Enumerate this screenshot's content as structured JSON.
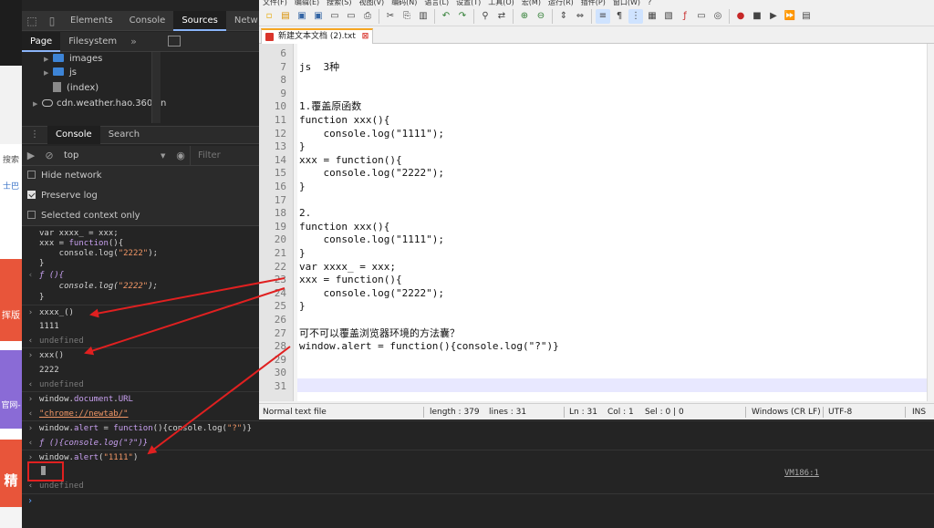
{
  "background_page": {
    "search_text": "搜索",
    "link_text": "士巴",
    "card1_label": "挥版",
    "card2_label": "官网-",
    "card3_label": "精"
  },
  "devtools": {
    "tabs": [
      "Elements",
      "Console",
      "Sources",
      "Netw"
    ],
    "active_tab": "Sources",
    "sources_nav": {
      "page_tab": "Page",
      "filesystem_tab": "Filesystem",
      "more": "»"
    },
    "tree": {
      "images": "images",
      "js": "js",
      "index": "(index)",
      "domain": "cdn.weather.hao.360.cn"
    },
    "drawer_tabs": {
      "console": "Console",
      "search": "Search"
    },
    "console_toolbar": {
      "context": "top",
      "filter_placeholder": "Filter"
    },
    "settings": {
      "hide_network": "Hide network",
      "preserve_log": "Preserve log",
      "selected_context": "Selected context only"
    },
    "console_lines": {
      "l1": "var xxxx_ = xxx;",
      "l2a": "xxx = ",
      "l2b": "function",
      "l2c": "(){",
      "l3a": "    console.log(",
      "l3b": "\"2222\"",
      "l3c": ");",
      "l4": "}",
      "l5a": "ƒ (){",
      "l6a": "    console.log(",
      "l6b": "\"2222\"",
      "l6c": ");",
      "l7": "}",
      "l8": "xxxx_()",
      "l9": "1111",
      "l10": "undefined",
      "l11": "xxx()",
      "l12": "2222",
      "l13": "undefined",
      "l14a": "window.",
      "l14b": "document",
      "l14c": ".",
      "l14d": "URL",
      "l15": "\"chrome://newtab/\"",
      "l16a": "window.",
      "l16b": "alert",
      "l16c": " = ",
      "l16d": "function",
      "l16e": "(){console.log(",
      "l16f": "\"?\"",
      "l16g": ")}",
      "l17": "ƒ (){console.log(\"?\")}",
      "l18a": "window.",
      "l18b": "alert",
      "l18c": "(",
      "l18d": "\"1111\"",
      "l18e": ")",
      "l19": "undefined",
      "vm_link": "VM186:1"
    }
  },
  "notepad": {
    "menu": [
      "文件(F)",
      "编辑(E)",
      "搜索(S)",
      "视图(V)",
      "编码(N)",
      "语言(L)",
      "设置(T)",
      "工具(O)",
      "宏(M)",
      "运行(R)",
      "插件(P)",
      "窗口(W)",
      "?"
    ],
    "tab_title": "新建文本文档 (2).txt",
    "lines": [
      {
        "n": "6",
        "t": ""
      },
      {
        "n": "7",
        "t": "js  3种"
      },
      {
        "n": "8",
        "t": ""
      },
      {
        "n": "9",
        "t": ""
      },
      {
        "n": "10",
        "t": "1.覆盖原函数"
      },
      {
        "n": "11",
        "t": "function xxx(){"
      },
      {
        "n": "12",
        "t": "    console.log(\"1111\");"
      },
      {
        "n": "13",
        "t": "}"
      },
      {
        "n": "14",
        "t": "xxx = function(){"
      },
      {
        "n": "15",
        "t": "    console.log(\"2222\");"
      },
      {
        "n": "16",
        "t": "}"
      },
      {
        "n": "17",
        "t": ""
      },
      {
        "n": "18",
        "t": "2."
      },
      {
        "n": "19",
        "t": "function xxx(){"
      },
      {
        "n": "20",
        "t": "    console.log(\"1111\");"
      },
      {
        "n": "21",
        "t": "}"
      },
      {
        "n": "22",
        "t": "var xxxx_ = xxx;"
      },
      {
        "n": "23",
        "t": "xxx = function(){"
      },
      {
        "n": "24",
        "t": "    console.log(\"2222\");"
      },
      {
        "n": "25",
        "t": "}"
      },
      {
        "n": "26",
        "t": ""
      },
      {
        "n": "27",
        "t": "可不可以覆盖浏览器环境的方法囊？"
      },
      {
        "n": "28",
        "t": "window.alert = function(){console.log(\"?\")}"
      },
      {
        "n": "29",
        "t": ""
      },
      {
        "n": "30",
        "t": ""
      },
      {
        "n": "31",
        "t": ""
      }
    ],
    "status": {
      "type": "Normal text file",
      "length": "length : 379",
      "lines": "lines : 31",
      "ln": "Ln : 31",
      "col": "Col : 1",
      "sel": "Sel : 0 | 0",
      "eol": "Windows (CR LF)",
      "encoding": "UTF-8",
      "mode": "INS"
    }
  },
  "colors": {
    "annotation": "#e02020",
    "tab_accent": "#f5a623"
  }
}
